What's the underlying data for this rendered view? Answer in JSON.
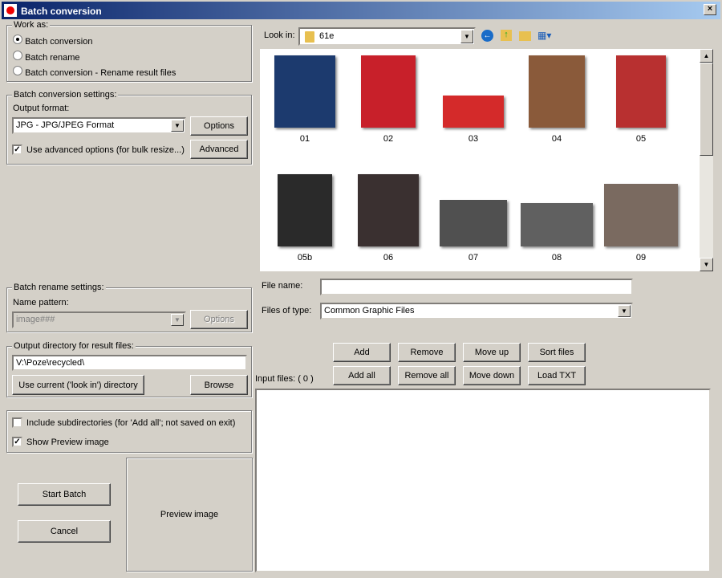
{
  "window": {
    "title": "Batch conversion",
    "close": "×"
  },
  "work_as": {
    "legend": "Work as:",
    "options": [
      "Batch conversion",
      "Batch rename",
      "Batch conversion - Rename result files"
    ],
    "selected": 0
  },
  "conversion": {
    "legend": "Batch conversion settings:",
    "output_format_label": "Output format:",
    "output_format": "JPG - JPG/JPEG Format",
    "options_button": "Options",
    "advanced_check": "Use advanced options (for bulk resize...)",
    "advanced_checked": true,
    "advanced_button": "Advanced"
  },
  "rename": {
    "legend": "Batch rename settings:",
    "pattern_label": "Name pattern:",
    "pattern": "image###",
    "options_button": "Options"
  },
  "output_dir": {
    "legend": "Output directory for result files:",
    "value": "V:\\Poze\\recycled\\",
    "use_current_button": "Use current ('look in') directory",
    "browse_button": "Browse"
  },
  "flags": {
    "include_subdirs": "Include subdirectories (for 'Add all'; not saved on exit)",
    "include_checked": false,
    "show_preview": "Show Preview image",
    "preview_checked": true
  },
  "actions": {
    "start": "Start Batch",
    "cancel": "Cancel"
  },
  "preview": {
    "label": "Preview image"
  },
  "browser": {
    "look_in_label": "Look in:",
    "look_in_value": "61e",
    "file_name_label": "File name:",
    "file_name": "",
    "files_of_type_label": "Files of type:",
    "files_of_type": "Common Graphic Files",
    "thumbnails": [
      {
        "name": "01",
        "color": "#1c3a6e"
      },
      {
        "name": "02",
        "color": "#c8202a"
      },
      {
        "name": "03",
        "color": "#d42a2a"
      },
      {
        "name": "04",
        "color": "#8a5a3a"
      },
      {
        "name": "05",
        "color": "#b83030"
      },
      {
        "name": "05b",
        "color": "#2a2a2a"
      },
      {
        "name": "06",
        "color": "#3a3030"
      },
      {
        "name": "07",
        "color": "#505050"
      },
      {
        "name": "08",
        "color": "#606060"
      },
      {
        "name": "09",
        "color": "#7a6a60"
      }
    ]
  },
  "list_buttons": {
    "add": "Add",
    "remove": "Remove",
    "move_up": "Move up",
    "sort": "Sort files",
    "add_all": "Add all",
    "remove_all": "Remove all",
    "move_down": "Move down",
    "load_txt": "Load TXT"
  },
  "input_files": {
    "label": "Input files: ( 0 )",
    "items": []
  }
}
